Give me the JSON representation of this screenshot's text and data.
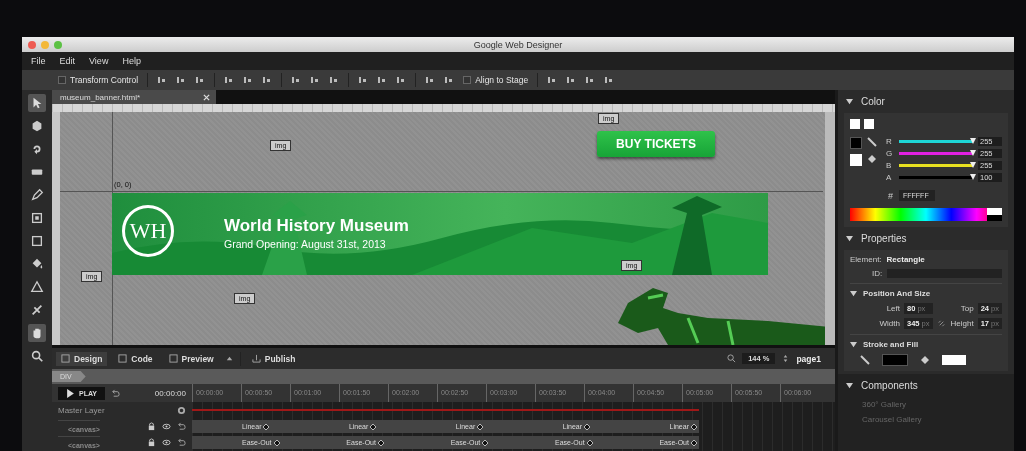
{
  "window": {
    "title": "Google Web Designer"
  },
  "menu": [
    "File",
    "Edit",
    "View",
    "Help"
  ],
  "toolbar": {
    "transform_control": {
      "label": "Transform Control",
      "checked": false
    },
    "align_to_stage": {
      "label": "Align to Stage",
      "checked": false
    }
  },
  "tools": [
    {
      "kind": "arrow",
      "selected": true
    },
    {
      "kind": "cube",
      "selected": false
    },
    {
      "kind": "rotate",
      "selected": false
    },
    {
      "kind": "tag",
      "selected": false
    },
    {
      "kind": "pen",
      "selected": false
    },
    {
      "kind": "frame",
      "selected": false
    },
    {
      "kind": "rect",
      "selected": false
    },
    {
      "kind": "bucket",
      "selected": false
    },
    {
      "kind": "triangle",
      "selected": false
    },
    {
      "kind": "stamp",
      "selected": false
    },
    {
      "kind": "hand",
      "selected": true
    },
    {
      "kind": "zoom",
      "selected": false
    }
  ],
  "document_tab": {
    "label": "museum_banner.html*"
  },
  "canvas": {
    "origin_label": "(0, 0)",
    "image_chips": [
      "img",
      "img",
      "img",
      "img",
      "img"
    ],
    "cta_button": "BUY TICKETS",
    "banner": {
      "logo": "WH",
      "title": "World History Museum",
      "subtitle": "Grand Opening: August 31st, 2013"
    }
  },
  "modes": [
    {
      "label": "Design",
      "selected": true
    },
    {
      "label": "Code",
      "selected": false
    },
    {
      "label": "Preview",
      "selected": false
    }
  ],
  "publish": "Publish",
  "zoom": "144 %",
  "page": "page1",
  "breadcrumb": "DIV",
  "timeline": {
    "play": "PLAY",
    "time": "00:00:00",
    "ticks": [
      "00:00:00",
      "00:00:50",
      "00:01:00",
      "00:01:50",
      "00:02:00",
      "00:02:50",
      "00:03:00",
      "00:03:50",
      "00:04:00",
      "00:04:50",
      "00:05:00",
      "00:05:50",
      "00:06:00"
    ],
    "master_layer": "Master Layer",
    "layers": [
      {
        "name": "<canvas>",
        "keyframes": [
          "Linear",
          "Linear",
          "Linear",
          "Linear",
          "Linear"
        ]
      },
      {
        "name": "<canvas>",
        "keyframes": [
          "Ease-Out",
          "Ease-Out",
          "Ease-Out",
          "Ease-Out",
          "Ease-Out"
        ]
      }
    ]
  },
  "color_panel": {
    "title": "Color",
    "channels": [
      {
        "name": "R",
        "value": "255",
        "level": 1,
        "color": "#1ed6d6"
      },
      {
        "name": "G",
        "value": "255",
        "level": 1,
        "color": "#e020e0"
      },
      {
        "name": "B",
        "value": "255",
        "level": 1,
        "color": "#e8e020"
      },
      {
        "name": "A",
        "value": "100",
        "level": 1,
        "color": "#000000"
      }
    ],
    "hex_label": "#",
    "hex": "FFFFFF"
  },
  "properties_panel": {
    "title": "Properties",
    "element_label": "Element:",
    "element": "Rectangle",
    "id_label": "ID:",
    "position_title": "Position And Size",
    "fields": [
      {
        "label": "Left",
        "value": "80",
        "unit": "px"
      },
      {
        "label": "Top",
        "value": "24",
        "unit": "px"
      },
      {
        "label": "Width",
        "value": "345",
        "unit": "px"
      },
      {
        "label": "Height",
        "value": "17",
        "unit": "px"
      }
    ],
    "stroke_title": "Stroke and Fill"
  },
  "components_panel": {
    "title": "Components",
    "items": [
      "360° Gallery",
      "Carousel Gallery"
    ]
  }
}
